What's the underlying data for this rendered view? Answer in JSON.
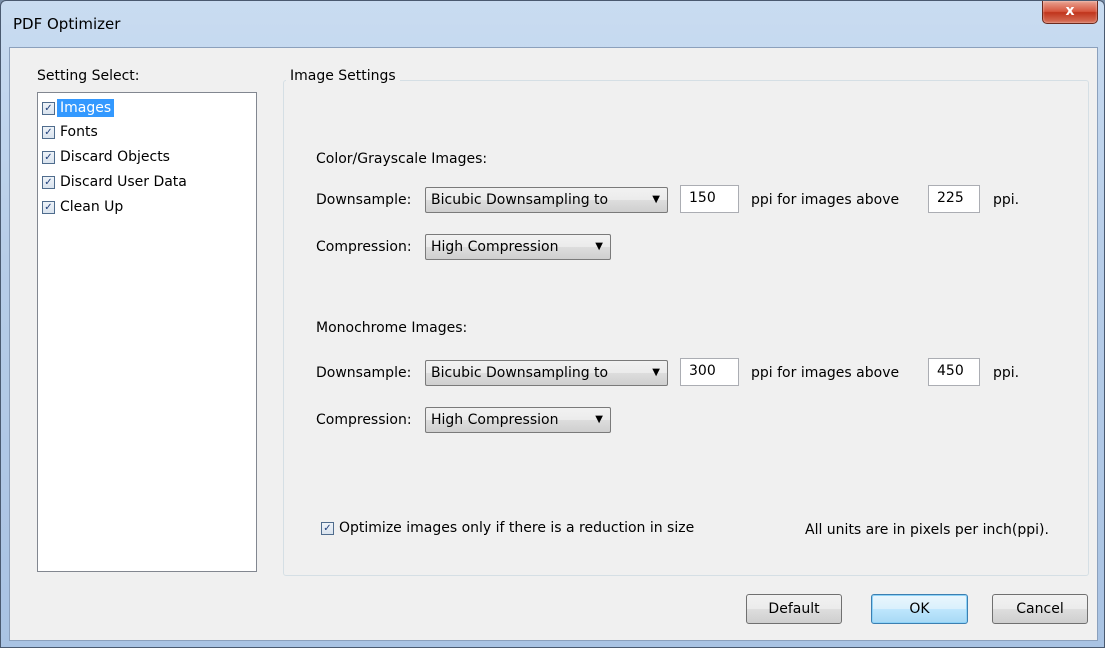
{
  "window": {
    "title": "PDF Optimizer",
    "close_label": "x"
  },
  "sidebar": {
    "label": "Setting Select:",
    "items": [
      {
        "label": "Images",
        "checked": true,
        "selected": true
      },
      {
        "label": "Fonts",
        "checked": true,
        "selected": false
      },
      {
        "label": "Discard Objects",
        "checked": true,
        "selected": false
      },
      {
        "label": "Discard User Data",
        "checked": true,
        "selected": false
      },
      {
        "label": "Clean Up",
        "checked": true,
        "selected": false
      }
    ]
  },
  "image_settings": {
    "title": "Image Settings",
    "color": {
      "heading": "Color/Grayscale Images:",
      "downsample_label": "Downsample:",
      "downsample_value": "Bicubic Downsampling to",
      "ppi_value": "150",
      "ppi_above_label": "ppi for images above",
      "above_value": "225",
      "ppi_unit": "ppi.",
      "compression_label": "Compression:",
      "compression_value": "High Compression"
    },
    "mono": {
      "heading": "Monochrome Images:",
      "downsample_label": "Downsample:",
      "downsample_value": "Bicubic Downsampling to",
      "ppi_value": "300",
      "ppi_above_label": "ppi for images above",
      "above_value": "450",
      "ppi_unit": "ppi.",
      "compression_label": "Compression:",
      "compression_value": "High Compression"
    },
    "optimize_only_reduction": {
      "label": "Optimize images only if there is a reduction in size",
      "checked": true
    },
    "units_note": "All units are in pixels per inch(ppi)."
  },
  "buttons": {
    "default": "Default",
    "ok": "OK",
    "cancel": "Cancel"
  },
  "icons": {
    "check": "✓",
    "dropdown": "▼"
  }
}
